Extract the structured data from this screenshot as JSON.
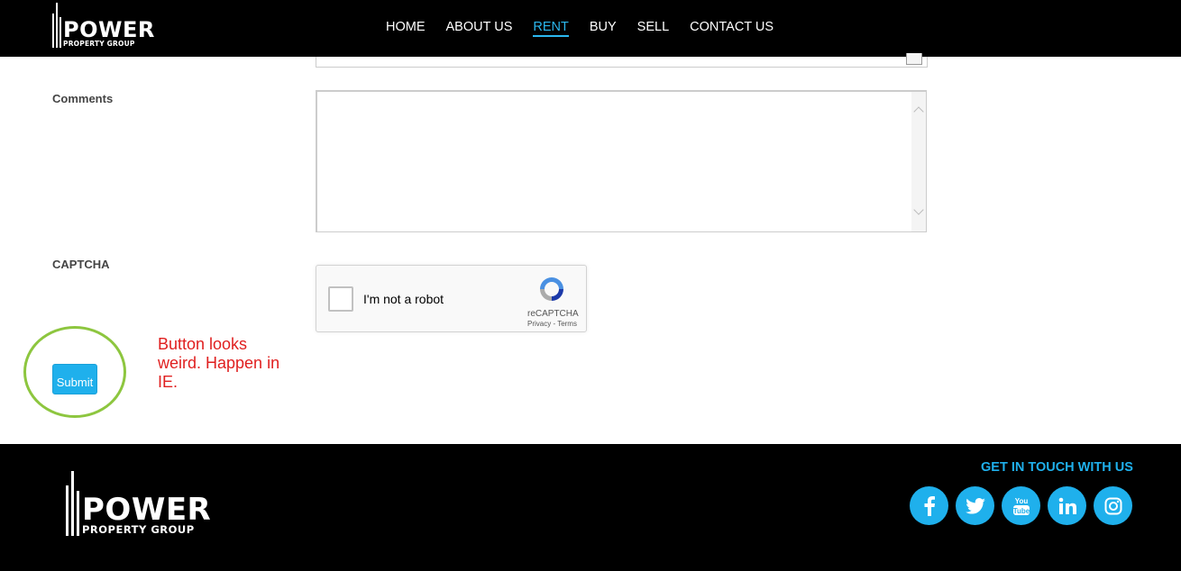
{
  "brand": {
    "name": "POWER",
    "tagline": "PROPERTY GROUP"
  },
  "nav": {
    "items": [
      {
        "label": "HOME"
      },
      {
        "label": "ABOUT US"
      },
      {
        "label": "RENT",
        "active": true
      },
      {
        "label": "BUY"
      },
      {
        "label": "SELL"
      },
      {
        "label": "CONTACT US"
      }
    ]
  },
  "form": {
    "comments_label": "Comments",
    "comments_value": "",
    "captcha_label": "CAPTCHA",
    "captcha": {
      "checkbox_text": "I'm not a robot",
      "brand": "reCAPTCHA",
      "links": "Privacy - Terms"
    },
    "submit_label": "Submit"
  },
  "annotation": {
    "text": "Button looks weird. Happen in IE.",
    "color": "#e02020",
    "circle_color": "#8dc63f"
  },
  "footer": {
    "brand": {
      "name": "POWER",
      "tagline": "PROPERTY GROUP"
    },
    "get_in_touch": "GET IN TOUCH WITH US",
    "socials": [
      {
        "icon": "facebook-icon"
      },
      {
        "icon": "twitter-icon"
      },
      {
        "icon": "youtube-icon"
      },
      {
        "icon": "linkedin-icon"
      },
      {
        "icon": "instagram-icon"
      }
    ]
  },
  "colors": {
    "accent": "#1fb0ec",
    "header_bg": "#000000"
  }
}
